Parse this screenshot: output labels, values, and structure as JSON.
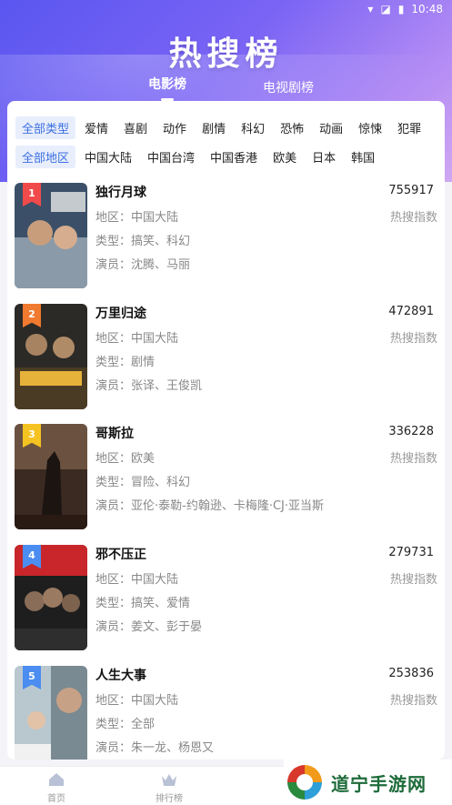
{
  "status": {
    "time": "10:48",
    "icons": [
      "wifi-icon",
      "signal-icon",
      "battery-icon"
    ]
  },
  "header": {
    "title": "热搜榜"
  },
  "tabs": [
    {
      "label": "电影榜",
      "active": true
    },
    {
      "label": "电视剧榜",
      "active": false
    }
  ],
  "filters": {
    "types": [
      "全部类型",
      "爱情",
      "喜剧",
      "动作",
      "剧情",
      "科幻",
      "恐怖",
      "动画",
      "惊悚",
      "犯罪"
    ],
    "regions": [
      "全部地区",
      "中国大陆",
      "中国台湾",
      "中国香港",
      "欧美",
      "日本",
      "韩国"
    ]
  },
  "labels": {
    "region": "地区：",
    "genre": "类型：",
    "cast": "演员：",
    "hot": "热搜指数"
  },
  "movies": [
    {
      "rank": "1",
      "name": "独行月球",
      "count": "755917",
      "region": "中国大陆",
      "genre": "搞笑、科幻",
      "cast": "沈腾、马丽",
      "rank_color": "#f04a4a"
    },
    {
      "rank": "2",
      "name": "万里归途",
      "count": "472891",
      "region": "中国大陆",
      "genre": "剧情",
      "cast": "张译、王俊凯",
      "rank_color": "#f07a2f"
    },
    {
      "rank": "3",
      "name": "哥斯拉",
      "count": "336228",
      "region": "欧美",
      "genre": "冒险、科幻",
      "cast": "亚伦·泰勒-约翰逊、卡梅隆·CJ·亚当斯",
      "rank_color": "#f5c321"
    },
    {
      "rank": "4",
      "name": "邪不压正",
      "count": "279731",
      "region": "中国大陆",
      "genre": "搞笑、爱情",
      "cast": "姜文、彭于晏",
      "rank_color": "#4b8df0"
    },
    {
      "rank": "5",
      "name": "人生大事",
      "count": "253836",
      "region": "中国大陆",
      "genre": "全部",
      "cast": "朱一龙、杨恩又",
      "rank_color": "#4b8df0"
    }
  ],
  "nav": [
    {
      "label": "首页",
      "icon": "home-icon"
    },
    {
      "label": "排行榜",
      "icon": "crown-icon"
    }
  ],
  "watermark": {
    "text": "道宁手游网"
  }
}
